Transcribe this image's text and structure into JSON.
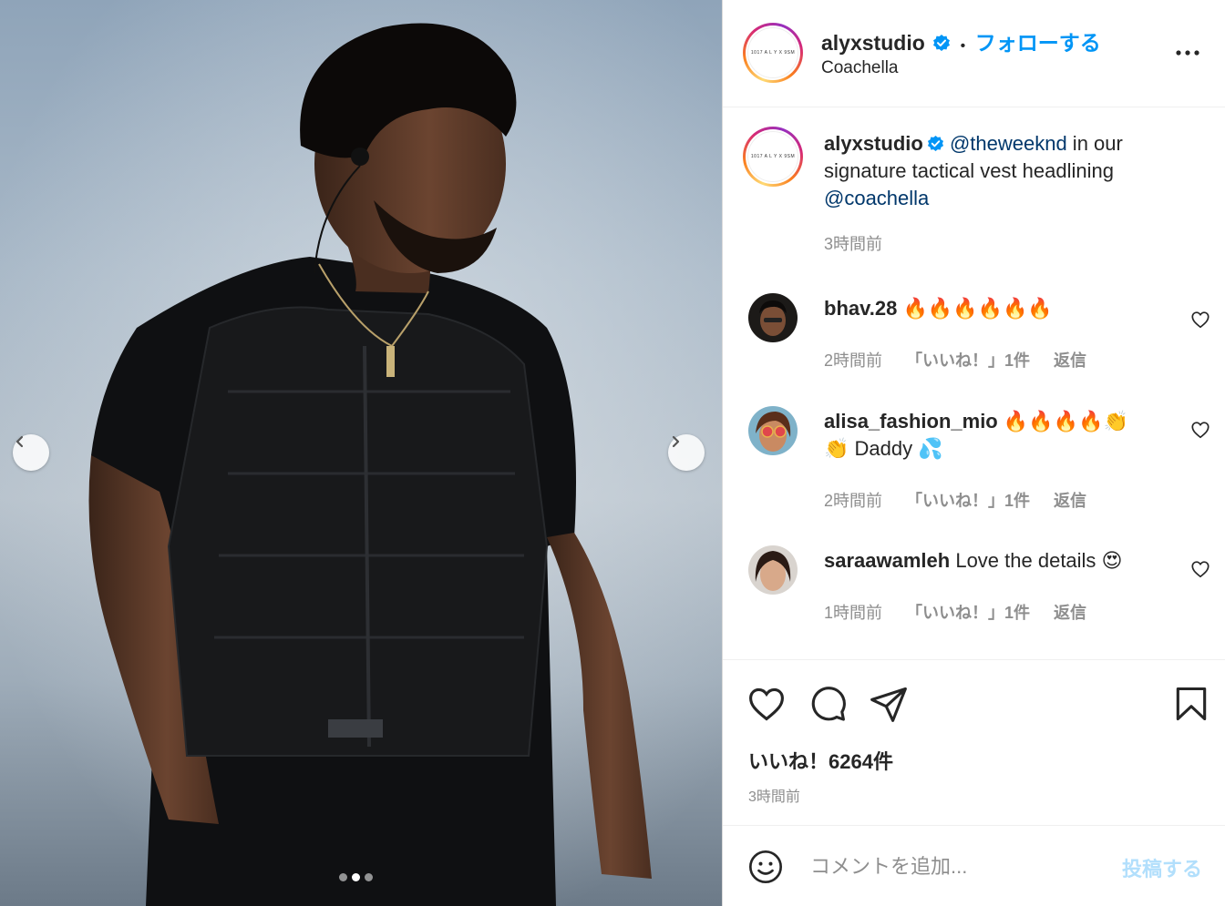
{
  "post": {
    "author": "alyxstudio",
    "follow_label": "フォローする",
    "separator": "•",
    "location": "Coachella",
    "logo_text": "1017 A L Y X 9SM",
    "caption": {
      "username": "alyxstudio",
      "mention1": "@theweeknd",
      "text": " in our signature tactical vest headlining ",
      "mention2": "@coachella",
      "time": "3時間前"
    },
    "likes_label": "いいね！6264件",
    "time": "3時間前"
  },
  "comments": [
    {
      "username": "bhav.28",
      "text": "🔥🔥🔥🔥🔥🔥",
      "time": "2時間前",
      "likes": "「いいね！」1件",
      "reply": "返信"
    },
    {
      "username": "alisa_fashion_mio",
      "text": "🔥🔥🔥🔥👏👏 Daddy 💦",
      "time": "2時間前",
      "likes": "「いいね！」1件",
      "reply": "返信"
    },
    {
      "username": "saraawamleh",
      "text": "Love the details 😍",
      "time": "1時間前",
      "likes": "「いいね！」1件",
      "reply": "返信"
    }
  ],
  "comment_box": {
    "placeholder": "コメントを追加...",
    "post_label": "投稿する"
  },
  "carousel": {
    "total": 3,
    "active": 2
  },
  "colors": {
    "accent": "#0095f6",
    "mention": "#00376b",
    "muted": "#8e8e8e",
    "post_disabled": "#b2dffc"
  },
  "icons": [
    "chevron-left-icon",
    "chevron-right-icon",
    "verified-badge-icon",
    "more-icon",
    "heart-icon",
    "comment-icon",
    "share-icon",
    "bookmark-icon",
    "emoji-icon"
  ]
}
